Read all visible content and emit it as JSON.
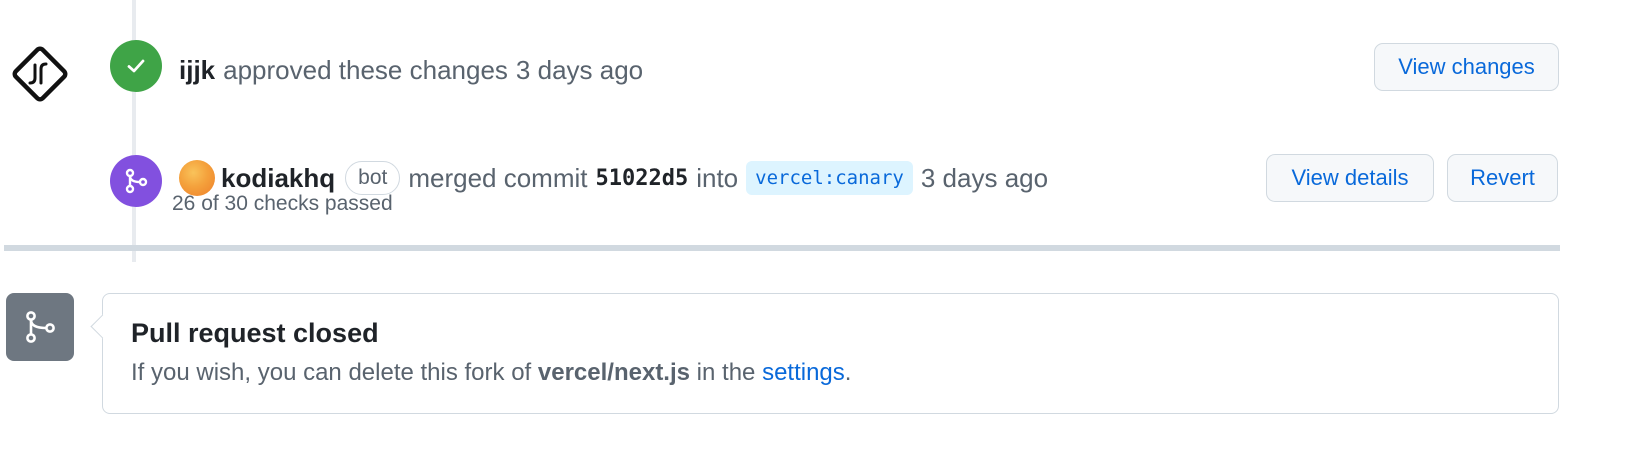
{
  "review_event": {
    "author": "ijjk",
    "action_text": "approved these changes",
    "time": "3 days ago",
    "view_changes_label": "View changes"
  },
  "merge_event": {
    "author": "kodiakhq",
    "bot_label": "bot",
    "action_text": "merged commit",
    "commit_sha": "51022d5",
    "into_text": "into",
    "branch_owner": "vercel",
    "branch_separator": ":",
    "branch_name": "canary",
    "time": "3 days ago",
    "checks_text": "26 of 30 checks passed",
    "view_details_label": "View details",
    "revert_label": "Revert"
  },
  "closed_notice": {
    "title": "Pull request closed",
    "desc_prefix": "If you wish, you can delete this fork of",
    "repo_name": "vercel/next.js",
    "desc_middle": "in the",
    "settings_link": "settings",
    "desc_suffix": "."
  },
  "icons": {
    "reviewer_avatar": "diamond-logo-icon",
    "approved_badge": "check-icon",
    "merged_badge": "git-merge-icon",
    "closed_badge": "git-pull-request-icon"
  },
  "colors": {
    "approved": "#3fa447",
    "merged": "#8250df",
    "closed": "#6e7781",
    "link": "#0969da",
    "branch_bg": "#ddf4ff"
  }
}
